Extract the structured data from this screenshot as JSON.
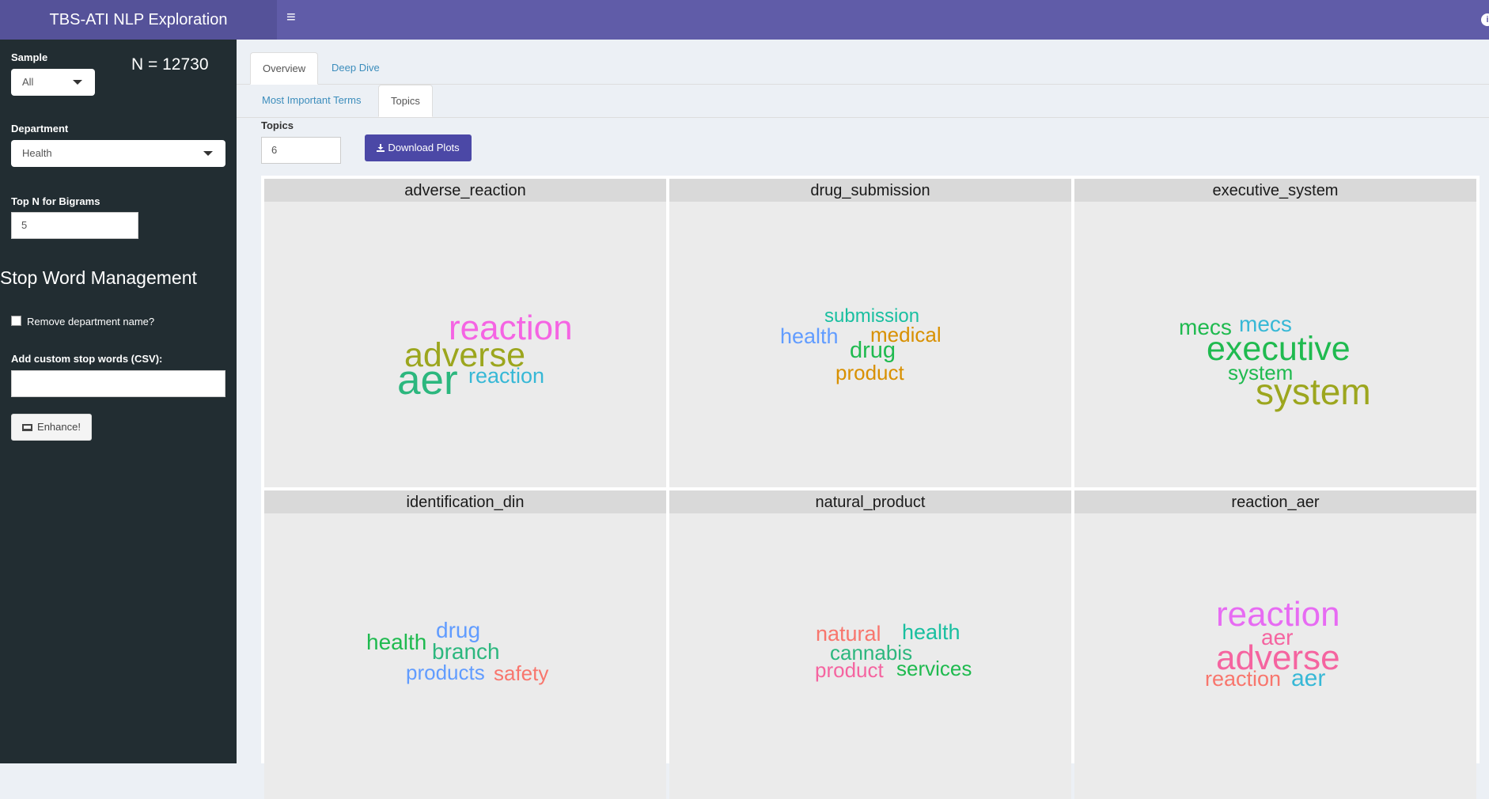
{
  "header": {
    "title": "TBS-ATI NLP Exploration"
  },
  "sidebar": {
    "sample_label": "Sample",
    "sample_value": "All",
    "n_count": "N = 12730",
    "department_label": "Department",
    "department_value": "Health",
    "bigrams_label": "Top N for Bigrams",
    "bigrams_value": "5",
    "stopword_title": "Stop Word Management",
    "remove_dept_label": "Remove department name?",
    "custom_stop_label": "Add custom stop words (CSV):",
    "custom_stop_value": "",
    "enhance_label": "Enhance!"
  },
  "tabs": {
    "overview": "Overview",
    "deep_dive": "Deep Dive"
  },
  "subtabs": {
    "most_important": "Most Important Terms",
    "topics": "Topics"
  },
  "controls": {
    "topics_label": "Topics",
    "topics_value": "6",
    "download_label": "Download Plots"
  },
  "panels": [
    {
      "title": "adverse_reaction",
      "words": [
        {
          "text": "reaction",
          "color": "#f564e3"
        },
        {
          "text": "adverse",
          "color": "#9ca61e"
        },
        {
          "text": "aer",
          "color": "#2cb77e"
        },
        {
          "text": "reaction",
          "color": "#37b8d6"
        }
      ]
    },
    {
      "title": "drug_submission",
      "words": [
        {
          "text": "submission",
          "color": "#19bfa0"
        },
        {
          "text": "health",
          "color": "#619cff"
        },
        {
          "text": "medical",
          "color": "#d89000"
        },
        {
          "text": "drug",
          "color": "#1fba4f"
        },
        {
          "text": "product",
          "color": "#d89000"
        }
      ]
    },
    {
      "title": "executive_system",
      "words": [
        {
          "text": "mecs",
          "color": "#1fba4f"
        },
        {
          "text": "mecs",
          "color": "#37b8d6"
        },
        {
          "text": "executive",
          "color": "#1fba4f"
        },
        {
          "text": "system",
          "color": "#1fba4f"
        },
        {
          "text": "system",
          "color": "#9ca61e"
        }
      ]
    },
    {
      "title": "identification_din",
      "words": [
        {
          "text": "health",
          "color": "#1fba4f"
        },
        {
          "text": "drug",
          "color": "#619cff"
        },
        {
          "text": "branch",
          "color": "#2cb77e"
        },
        {
          "text": "products",
          "color": "#619cff"
        },
        {
          "text": "safety",
          "color": "#f8766d"
        }
      ]
    },
    {
      "title": "natural_product",
      "words": [
        {
          "text": "natural",
          "color": "#f8766d"
        },
        {
          "text": "health",
          "color": "#19bfa0"
        },
        {
          "text": "cannabis",
          "color": "#2cb77e"
        },
        {
          "text": "product",
          "color": "#f564a0"
        },
        {
          "text": "services",
          "color": "#1fba4f"
        }
      ]
    },
    {
      "title": "reaction_aer",
      "words": [
        {
          "text": "reaction",
          "color": "#e76bf3"
        },
        {
          "text": "aer",
          "color": "#f564a0"
        },
        {
          "text": "adverse",
          "color": "#f564a0"
        },
        {
          "text": "reaction",
          "color": "#f8766d"
        },
        {
          "text": "aer",
          "color": "#37b8d6"
        }
      ]
    }
  ]
}
